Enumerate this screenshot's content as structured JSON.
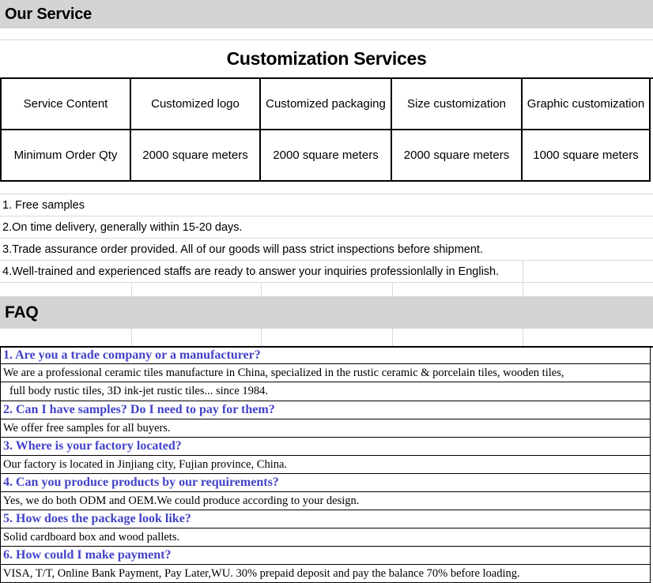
{
  "sections": {
    "our_service": "Our Service",
    "faq": "FAQ"
  },
  "customization": {
    "title": "Customization Services",
    "columns": [
      "Service Content",
      "Customized logo",
      "Customized packaging",
      "Size customization",
      "Graphic customization"
    ],
    "row": [
      "Minimum Order Qty",
      "2000 square meters",
      "2000 square meters",
      "2000 square meters",
      "1000 square meters"
    ]
  },
  "features": [
    "1. Free samples",
    "2.On time delivery, generally within 15-20 days.",
    "3.Trade assurance order provided. All of our goods will pass strict inspections before shipment.",
    "4.Well-trained and experienced staffs are ready to answer your inquiries professionlally in English."
  ],
  "faq_items": [
    {
      "question": "1. Are you a trade company or a manufacturer?",
      "answers": [
        "We are a professional ceramic tiles manufacture in China, specialized in the rustic ceramic & porcelain tiles, wooden tiles,",
        " full body rustic tiles, 3D ink-jet rustic tiles... since 1984."
      ]
    },
    {
      "question": "2. Can I have samples? Do I need to pay for them?",
      "answers": [
        "We offer free samples for all buyers."
      ]
    },
    {
      "question": "3. Where is your factory located?",
      "answers": [
        "Our factory is located in Jinjiang city, Fujian province, China."
      ]
    },
    {
      "question": "4. Can you produce products by our requirements?",
      "answers": [
        "Yes, we do both ODM and OEM.We could produce according to your design."
      ]
    },
    {
      "question": "5. How does the package look like?",
      "answers": [
        "Solid cardboard box and wood pallets."
      ]
    },
    {
      "question": "6. How could I make payment?",
      "answers": [
        "VISA, T/T, Online Bank Payment, Pay Later,WU. 30% prepaid deposit and pay the balance 70% before loading."
      ]
    }
  ],
  "colors": {
    "section_band": "#d4d4d4",
    "faq_question": "#4242c8",
    "grid_line": "#d9d9d9",
    "table_border": "#000000"
  }
}
